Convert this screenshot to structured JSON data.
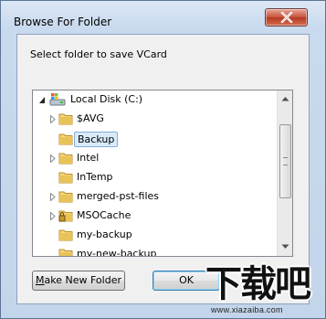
{
  "window": {
    "title": "Browse For Folder"
  },
  "dialog": {
    "prompt": "Select folder to save VCard"
  },
  "tree": {
    "root": {
      "label": "Local Disk (C:)"
    },
    "items": [
      {
        "label": "$AVG",
        "expandable": true,
        "selected": false,
        "locked": false
      },
      {
        "label": "Backup",
        "expandable": false,
        "selected": true,
        "locked": false
      },
      {
        "label": "Intel",
        "expandable": true,
        "selected": false,
        "locked": false
      },
      {
        "label": "InTemp",
        "expandable": false,
        "selected": false,
        "locked": false
      },
      {
        "label": "merged-pst-files",
        "expandable": true,
        "selected": false,
        "locked": false
      },
      {
        "label": "MSOCache",
        "expandable": true,
        "selected": false,
        "locked": true
      },
      {
        "label": "my-backup",
        "expandable": false,
        "selected": false,
        "locked": false
      },
      {
        "label": "my-new-backup",
        "expandable": false,
        "selected": false,
        "locked": false
      }
    ]
  },
  "buttons": {
    "make_new_folder": "Make New Folder",
    "make_new_folder_mnemonic": "M",
    "make_new_folder_rest": "ake New Folder",
    "ok": "OK"
  },
  "watermark": {
    "logo_text": "下载吧",
    "url": "www.xiazaiba.com"
  },
  "colors": {
    "selection_bg": "#d9ebfb",
    "selection_border": "#84acdd",
    "folder": "#e8c35a",
    "close_button": "#c7503b"
  }
}
